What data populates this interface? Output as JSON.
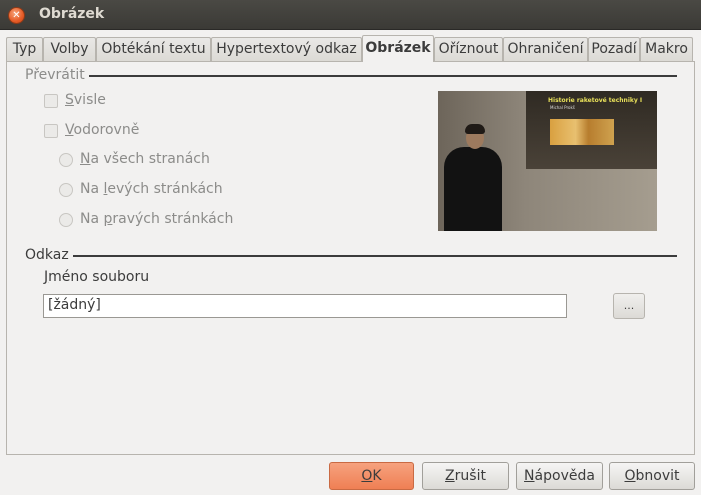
{
  "window": {
    "title": "Obrázek"
  },
  "tabs": [
    {
      "label": "Typ"
    },
    {
      "label": "Volby"
    },
    {
      "label": "Obtékání textu"
    },
    {
      "label": "Hypertextový odkaz"
    },
    {
      "label": "Obrázek"
    },
    {
      "label": "Oříznout"
    },
    {
      "label": "Ohraničení"
    },
    {
      "label": "Pozadí"
    },
    {
      "label": "Makro"
    }
  ],
  "flip": {
    "section_label": "Převrátit",
    "vertical": {
      "label_u": "S",
      "label_rest": "visle",
      "checked": false
    },
    "horizontal": {
      "label_u": "V",
      "label_rest": "odorovně",
      "checked": false
    },
    "all_pages": {
      "label_u": "N",
      "label_rest": "a všech stranách"
    },
    "left_pages": {
      "label_pre": "Na ",
      "label_u": "l",
      "label_rest": "evých stránkách"
    },
    "right_pages": {
      "label_pre": "Na ",
      "label_u": "p",
      "label_rest": "ravých stránkách"
    }
  },
  "preview": {
    "slide_title": "Historie raketové techniky I",
    "slide_subtitle": "Michal Prokš"
  },
  "link": {
    "section_label": "Odkaz",
    "filename_label_u": "J",
    "filename_label_rest": "méno souboru",
    "filename_value": "[žádný]",
    "browse_label": "..."
  },
  "buttons": {
    "ok_u": "O",
    "ok_rest": "K",
    "cancel_u": "Z",
    "cancel_rest": "rušit",
    "help_u": "N",
    "help_rest": "ápověda",
    "reset_u": "O",
    "reset_rest": "bnovit"
  }
}
